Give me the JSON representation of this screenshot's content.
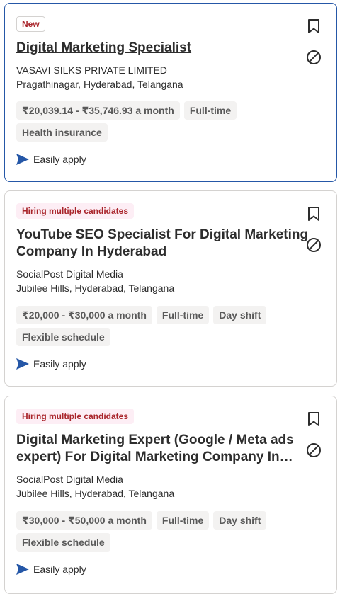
{
  "jobs": [
    {
      "badge": "New",
      "title": "Digital Marketing Specialist",
      "company": "VASAVI SILKS PRIVATE LIMITED",
      "location": "Pragathinagar, Hyderabad, Telangana",
      "chips_row1": [
        "₹20,039.14 - ₹35,746.93 a month",
        "Full-time"
      ],
      "chips_row2": [
        "Health insurance"
      ],
      "apply": "Easily apply"
    },
    {
      "badge": "Hiring multiple candidates",
      "title_line1": "YouTube SEO Specialist For Digital Marketing",
      "title_line2": "Company In Hyderabad",
      "company": "SocialPost Digital Media",
      "location": "Jubilee Hills, Hyderabad, Telangana",
      "chips_row1": [
        "₹20,000 - ₹30,000 a month",
        "Full-time",
        "Day shift"
      ],
      "chips_row2": [
        "Flexible schedule"
      ],
      "apply": "Easily apply"
    },
    {
      "badge": "Hiring multiple candidates",
      "title_line1": "Digital Marketing Expert (Google / Meta ads",
      "title_line2": "expert) For Digital Marketing Company In…",
      "company": "SocialPost Digital Media",
      "location": "Jubilee Hills, Hyderabad, Telangana",
      "chips_row1": [
        "₹30,000 - ₹50,000 a month",
        "Full-time",
        "Day shift"
      ],
      "chips_row2": [
        "Flexible schedule"
      ],
      "apply": "Easily apply"
    }
  ],
  "icons": {
    "save": "bookmark-icon",
    "hide": "not-interested-icon",
    "apply": "send-arrow-icon"
  },
  "colors": {
    "selected_border": "#2557a7",
    "badge_text": "#a9252b",
    "hiring_badge_bg": "#fdeef5",
    "chip_bg": "#f3f2f1",
    "apply_arrow": "#2557a7"
  }
}
